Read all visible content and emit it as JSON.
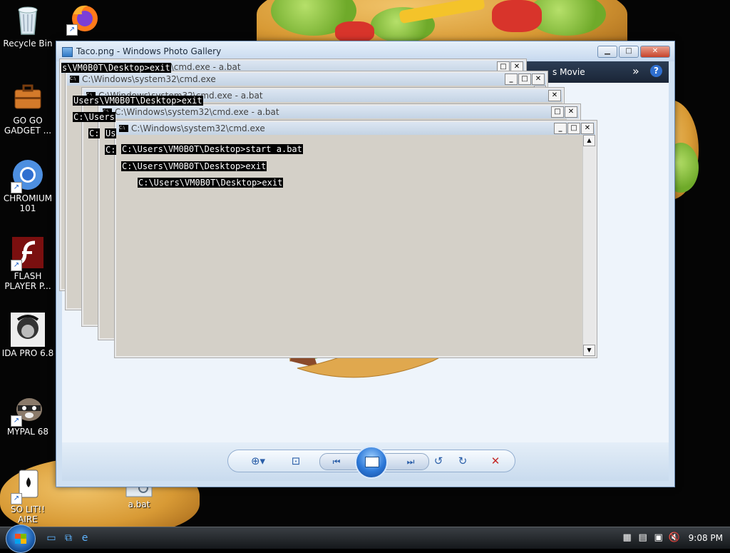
{
  "desktop_icons": [
    {
      "id": "recycle-bin",
      "label": "Recycle Bin"
    },
    {
      "id": "firefox",
      "label": ""
    },
    {
      "id": "go-go-gadget",
      "label": "GO GO\nGADGET ..."
    },
    {
      "id": "chromium",
      "label": "CHROMIUM\n101"
    },
    {
      "id": "flash-player",
      "label": "FLASH\nPLAYER P..."
    },
    {
      "id": "ida-pro",
      "label": "IDA PRO 6.8"
    },
    {
      "id": "mypal",
      "label": "MYPAL 68"
    },
    {
      "id": "so-lit-aire",
      "label": "SO LIT!! AIRE"
    },
    {
      "id": "a-bat",
      "label": "a.bat"
    }
  ],
  "photo_gallery": {
    "title": "Taco.png - Windows Photo Gallery",
    "menu_movie": "s Movie",
    "more": "»",
    "help": "?",
    "window_buttons": {
      "minimize": "▁",
      "maximize": "□",
      "close": "✕"
    },
    "controls": {
      "zoom": "⊕▾",
      "fit": "⊡",
      "prev": "⏮",
      "next": "⏭",
      "rotate_ccw": "↺",
      "rotate_cw": "↻",
      "delete": "✕"
    }
  },
  "cmd_windows": [
    {
      "title": "C:\\Windows\\system32\\cmd.exe - a.bat"
    },
    {
      "title": "C:\\Windows\\system32\\cmd.exe"
    },
    {
      "title": "C:\\Windows\\system32\\cmd.exe - a.bat"
    },
    {
      "title": "C:\\Windows\\system32\\cmd.exe - a.bat"
    },
    {
      "title": "C:\\Windows\\system32\\cmd.exe"
    }
  ],
  "cmd_lines": {
    "l1": "s\\VM0B0T\\Desktop>exit",
    "l2": "Users\\VM0B0T\\Desktop>exit",
    "l3": "C:\\Users",
    "l4": "C:",
    "l5": "C:",
    "l6": "C:\\Users\\VM0B0T\\Desktop>start a.bat",
    "l7": "C:\\Users\\VM0B0T\\Desktop>exit",
    "l8": "C:\\Users\\VM0B0T\\Desktop>exit",
    "l9": "Us"
  },
  "window_glyphs": {
    "min": "_",
    "max": "□",
    "close": "✕",
    "up": "▲",
    "down": "▼"
  },
  "taskbar": {
    "clock": "9:08 PM",
    "quicklaunch": [
      "show-desktop",
      "switch-windows",
      "internet-explorer"
    ]
  }
}
